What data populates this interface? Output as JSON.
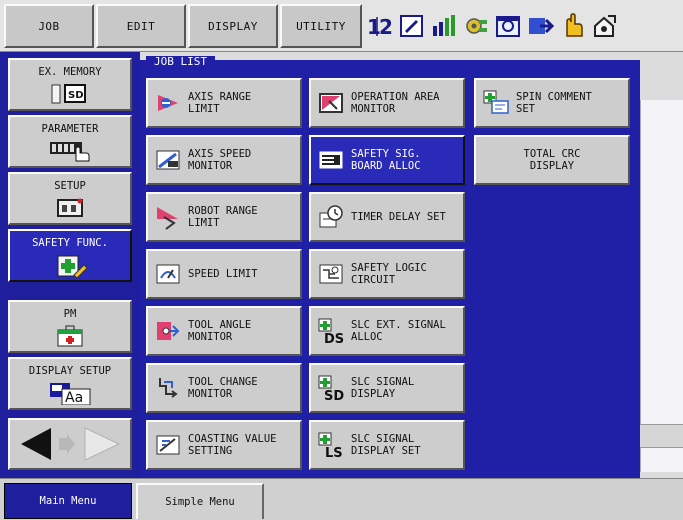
{
  "topbar": {
    "menus": [
      {
        "label": "JOB"
      },
      {
        "label": "EDIT"
      },
      {
        "label": "DISPLAY"
      },
      {
        "label": "UTILITY"
      }
    ],
    "status_icons": [
      "sequence-icon",
      "edit-mode-icon",
      "chart-icon",
      "gear-icon",
      "tool-icon",
      "arrow-icon",
      "hand-icon",
      "lock-icon"
    ]
  },
  "sidebar": {
    "items": [
      {
        "label": "EX. MEMORY",
        "icon": "sd-card-icon"
      },
      {
        "label": "PARAMETER",
        "icon": "hand-keyboard-icon"
      },
      {
        "label": "SETUP",
        "icon": "setup-box-icon"
      },
      {
        "label": "SAFETY FUNC.",
        "icon": "safety-cross-icon"
      },
      {
        "label": "PM",
        "icon": "first-aid-icon"
      },
      {
        "label": "DISPLAY SETUP",
        "icon": "display-font-icon"
      }
    ],
    "nav": {
      "back_icon": "arrow-left-icon",
      "forward_icon": "arrow-right-icon"
    }
  },
  "job_list": {
    "title": "JOB LIST",
    "col1": [
      {
        "label": "AXIS RANGE\n LIMIT",
        "icon": "axis-range-icon"
      },
      {
        "label": "AXIS SPEED\n MONITOR",
        "icon": "axis-speed-icon"
      },
      {
        "label": "ROBOT RANGE\n LIMIT",
        "icon": "robot-range-icon"
      },
      {
        "label": "SPEED LIMIT",
        "icon": "speed-limit-icon"
      },
      {
        "label": "TOOL ANGLE\n MONITOR",
        "icon": "tool-angle-icon"
      },
      {
        "label": "TOOL CHANGE\n MONITOR",
        "icon": "tool-change-icon"
      },
      {
        "label": "COASTING VALUE\n SETTING",
        "icon": "coasting-icon"
      }
    ],
    "col2": [
      {
        "label": "OPERATION AREA\n MONITOR",
        "icon": "operation-area-icon"
      },
      {
        "label": "SAFETY SIG.\n BOARD ALLOC",
        "icon": "safety-board-icon"
      },
      {
        "label": "TIMER DELAY SET",
        "icon": "timer-icon"
      },
      {
        "label": "SAFETY LOGIC\n CIRCUIT",
        "icon": "logic-circuit-icon"
      },
      {
        "label": "SLC EXT. SIGNAL\n ALLOC",
        "icon": "slc-ds-icon"
      },
      {
        "label": "SLC SIGNAL\n DISPLAY",
        "icon": "slc-sd-icon"
      },
      {
        "label": "SLC SIGNAL\n DISPLAY SET",
        "icon": "slc-ls-icon"
      }
    ],
    "col3": [
      {
        "label": "SPIN COMMENT\n SET",
        "icon": "spin-comment-icon"
      },
      {
        "label": "TOTAL CRC\nDISPLAY"
      }
    ]
  },
  "bottombar": {
    "main_menu": "Main Menu",
    "simple_menu": "Simple Menu"
  },
  "colors": {
    "frame_blue": "#2020a6",
    "selected_blue": "#2a2ab8",
    "button_gray": "#cdcdcd"
  }
}
